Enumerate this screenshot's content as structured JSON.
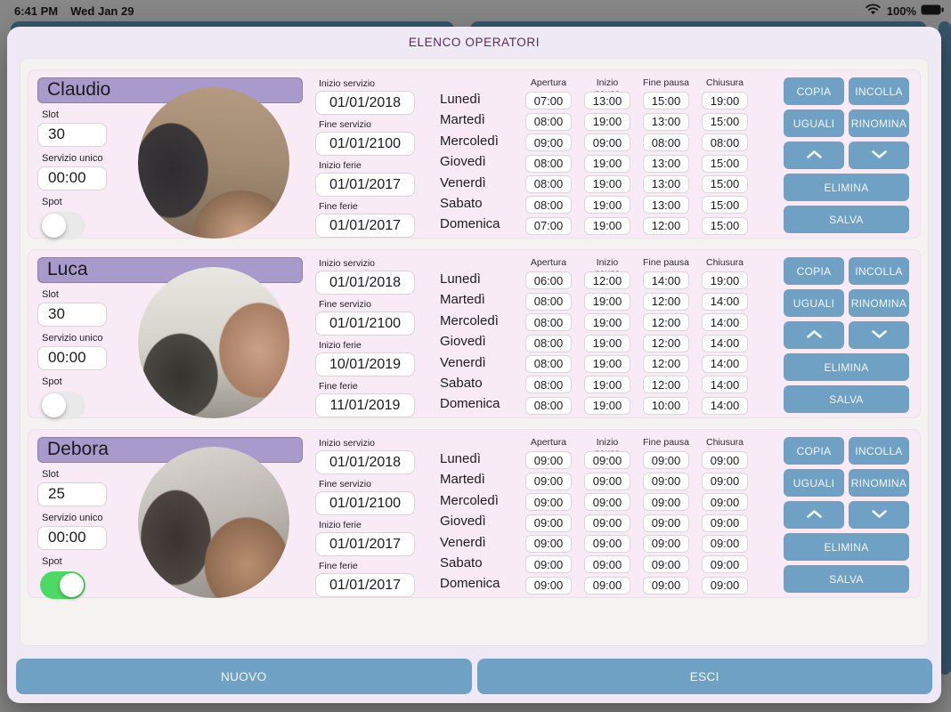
{
  "status_bar": {
    "time": "6:41 PM",
    "date": "Wed Jan 29",
    "battery": "100%"
  },
  "header": {
    "title": "ELENCO OPERATORI"
  },
  "labels": {
    "slot": "Slot",
    "servizio_unico": "Servizio unico",
    "spot": "Spot",
    "inizio_servizio": "Inizio servizio",
    "fine_servizio": "Fine servizio",
    "inizio_ferie": "Inizio ferie",
    "fine_ferie": "Fine ferie"
  },
  "schedule_headers": [
    "Apertura",
    "Inizio pausa",
    "Fine pausa",
    "Chiusura"
  ],
  "days": [
    "Lunedì",
    "Martedì",
    "Mercoledì",
    "Giovedì",
    "Venerdì",
    "Sabato",
    "Domenica"
  ],
  "card_buttons": {
    "copia": "COPIA",
    "incolla": "INCOLLA",
    "uguali": "UGUALI",
    "rinomina": "RINOMINA",
    "elimina": "ELIMINA",
    "salva": "SALVA"
  },
  "icons": {
    "chevron_up": "chevron-up-icon",
    "chevron_down": "chevron-down-icon",
    "wifi": "wifi-icon",
    "battery": "battery-icon"
  },
  "operators": [
    {
      "name": "Claudio",
      "slot": "30",
      "servizio_unico": "00:00",
      "spot_on": false,
      "inizio_servizio": "01/01/2018",
      "fine_servizio": "01/01/2100",
      "inizio_ferie": "01/01/2017",
      "fine_ferie": "01/01/2017",
      "schedule": [
        [
          "07:00",
          "13:00",
          "15:00",
          "19:00"
        ],
        [
          "08:00",
          "19:00",
          "13:00",
          "15:00"
        ],
        [
          "09:00",
          "09:00",
          "08:00",
          "08:00"
        ],
        [
          "08:00",
          "19:00",
          "13:00",
          "15:00"
        ],
        [
          "08:00",
          "19:00",
          "13:00",
          "15:00"
        ],
        [
          "08:00",
          "19:00",
          "13:00",
          "15:00"
        ],
        [
          "07:00",
          "19:00",
          "12:00",
          "15:00"
        ]
      ]
    },
    {
      "name": "Luca",
      "slot": "30",
      "servizio_unico": "00:00",
      "spot_on": false,
      "inizio_servizio": "01/01/2018",
      "fine_servizio": "01/01/2100",
      "inizio_ferie": "10/01/2019",
      "fine_ferie": "11/01/2019",
      "schedule": [
        [
          "06:00",
          "12:00",
          "14:00",
          "19:00"
        ],
        [
          "08:00",
          "19:00",
          "12:00",
          "14:00"
        ],
        [
          "08:00",
          "19:00",
          "12:00",
          "14:00"
        ],
        [
          "08:00",
          "19:00",
          "12:00",
          "14:00"
        ],
        [
          "08:00",
          "19:00",
          "12:00",
          "14:00"
        ],
        [
          "08:00",
          "19:00",
          "12:00",
          "14:00"
        ],
        [
          "08:00",
          "19:00",
          "10:00",
          "14:00"
        ]
      ]
    },
    {
      "name": "Debora",
      "slot": "25",
      "servizio_unico": "00:00",
      "spot_on": true,
      "inizio_servizio": "01/01/2018",
      "fine_servizio": "01/01/2100",
      "inizio_ferie": "01/01/2017",
      "fine_ferie": "01/01/2017",
      "schedule": [
        [
          "09:00",
          "09:00",
          "09:00",
          "09:00"
        ],
        [
          "09:00",
          "09:00",
          "09:00",
          "09:00"
        ],
        [
          "09:00",
          "09:00",
          "09:00",
          "09:00"
        ],
        [
          "09:00",
          "09:00",
          "09:00",
          "09:00"
        ],
        [
          "09:00",
          "09:00",
          "09:00",
          "09:00"
        ],
        [
          "09:00",
          "09:00",
          "09:00",
          "09:00"
        ],
        [
          "09:00",
          "09:00",
          "09:00",
          "09:00"
        ]
      ]
    }
  ],
  "footer": {
    "nuovo": "NUOVO",
    "esci": "ESCI"
  },
  "colors": {
    "accent_blue": "#6fa1c4",
    "name_bar_purple": "#a89aca",
    "toggle_on_green": "#4cd964",
    "title_plum": "#562c55",
    "card_pink": "#f8ebf5",
    "panel_bg": "#f5f3f1",
    "modal_bg": "#eee9f5",
    "teal_backdrop": "#35566a",
    "backdrop_gray": "#868686"
  }
}
